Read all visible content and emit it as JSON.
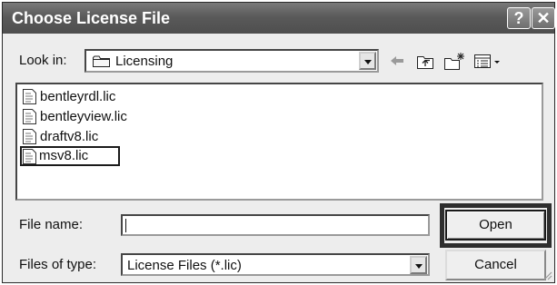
{
  "dialog": {
    "title": "Choose License File",
    "help_glyph": "?",
    "close_glyph": "✕"
  },
  "look_in": {
    "label": "Look in:",
    "value": "Licensing",
    "folder_icon": "folder-icon"
  },
  "toolbar": {
    "icons": [
      "back-arrow-icon",
      "up-folder-icon",
      "new-folder-icon",
      "views-menu-icon"
    ]
  },
  "files": [
    {
      "name": "bentleyrdl.lic",
      "selected": false
    },
    {
      "name": "bentleyview.lic",
      "selected": false
    },
    {
      "name": "draftv8.lic",
      "selected": false
    },
    {
      "name": "msv8.lic",
      "selected": true
    }
  ],
  "file_name": {
    "label": "File name:",
    "value": ""
  },
  "file_type": {
    "label": "Files of type:",
    "value": "License Files (*.lic)"
  },
  "buttons": {
    "open": "Open",
    "cancel": "Cancel"
  }
}
